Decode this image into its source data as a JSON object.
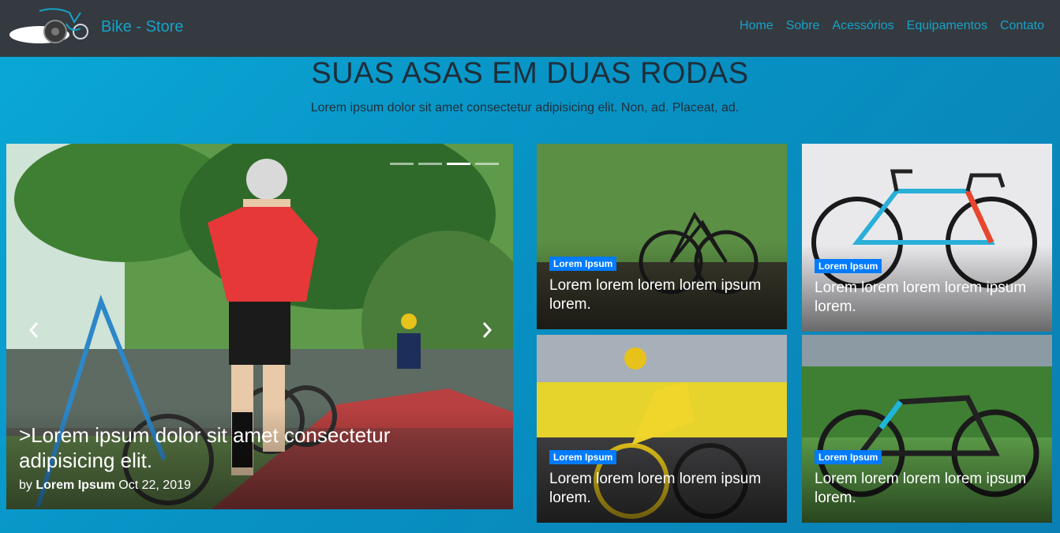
{
  "navbar": {
    "brand": "Bike - Store",
    "links": [
      "Home",
      "Sobre",
      "Acessórios",
      "Equipamentos",
      "Contato"
    ]
  },
  "hero": {
    "title": "SUAS ASAS EM DUAS RODAS",
    "subtitle": "Lorem ipsum dolor sit amet consectetur adipisicing elit. Non, ad. Placeat, ad."
  },
  "carousel": {
    "title": ">Lorem ipsum dolor sit amet consectetur adipisicing elit.",
    "by": "by",
    "author": "Lorem Ipsum",
    "date": "Oct 22, 2019",
    "prev_icon": "chevron-left-icon",
    "next_icon": "chevron-right-icon"
  },
  "cards": [
    {
      "badge": "Lorem Ipsum",
      "title": "Lorem lorem lorem lorem ipsum lorem."
    },
    {
      "badge": "Lorem Ipsum",
      "title": "Lorem lorem lorem lorem ipsum lorem."
    },
    {
      "badge": "Lorem Ipsum",
      "title": "Lorem lorem lorem lorem ipsum lorem."
    },
    {
      "badge": "Lorem Ipsum",
      "title": "Lorem lorem lorem lorem ipsum lorem."
    }
  ],
  "colors": {
    "navbar_bg": "#343a40",
    "link": "#17a2c8",
    "badge": "#007bff",
    "page_bg": "#0aa9d6"
  }
}
